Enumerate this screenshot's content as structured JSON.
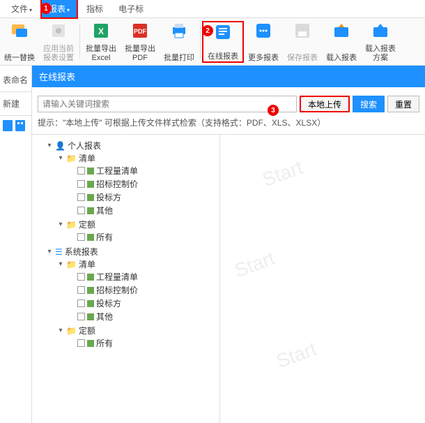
{
  "menu": {
    "file": "文件",
    "report": "报表",
    "indicator": "指标",
    "etag": "电子标"
  },
  "toolbar": {
    "unify_replace": "统一替换",
    "apply_current": "应用当前\n报表设置",
    "batch_excel": "批量导出\nExcel",
    "batch_pdf": "批量导出\nPDF",
    "batch_print": "批量打印",
    "online_report": "在线报表",
    "more_report": "更多报表",
    "save_report": "保存报表",
    "load_report": "载入报表",
    "load_scheme": "载入报表\n方案"
  },
  "leftstrip": {
    "rename": "表命名",
    "new": "新建"
  },
  "header": {
    "title": "在线报表"
  },
  "search": {
    "placeholder": "请输入关键词搜索",
    "local_upload": "本地上传",
    "search_btn": "搜索",
    "reset_btn": "重置"
  },
  "hint": "提示：\"本地上传\" 可根据上传文件样式检索（支持格式：PDF、XLS、XLSX）",
  "tree": {
    "personal": "个人报表",
    "system": "系统报表",
    "list": "清单",
    "quota": "定额",
    "qty_list": "工程量清单",
    "tender_ctrl": "招标控制价",
    "bidder": "投标方",
    "other": "其他",
    "all": "所有"
  },
  "badges": {
    "b1": "1",
    "b2": "2",
    "b3": "3"
  }
}
